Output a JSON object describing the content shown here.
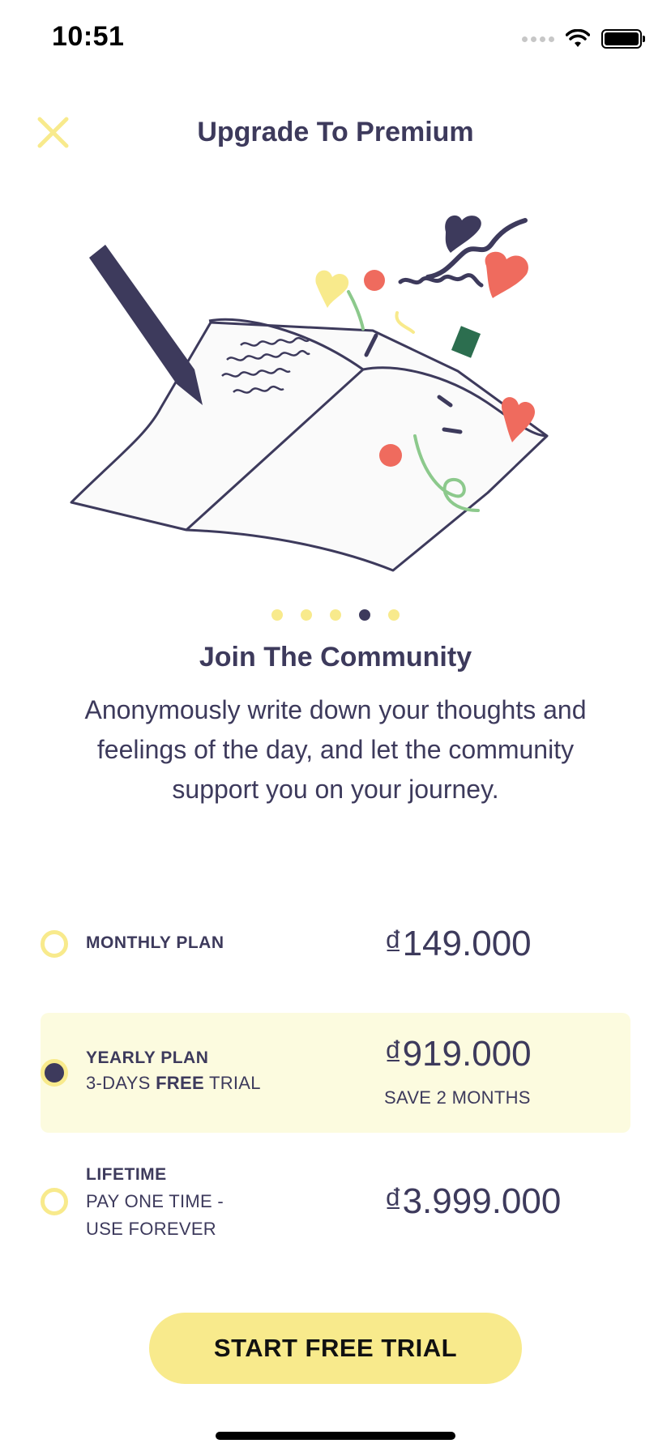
{
  "status_bar": {
    "time": "10:51"
  },
  "header": {
    "title": "Upgrade To Premium"
  },
  "colors": {
    "accent_yellow": "#f8ea8c",
    "text_navy": "#3d3a5c",
    "selected_bg": "#fcfbdf"
  },
  "pager": {
    "count": 5,
    "active_index": 3
  },
  "feature": {
    "title": "Join The Community",
    "description": "Anonymously write down your thoughts and feelings of the day, and let the community support you on your journey."
  },
  "plans": {
    "monthly": {
      "name": "MONTHLY PLAN",
      "price": "₫149.000"
    },
    "yearly": {
      "name": "YEARLY PLAN",
      "sub_prefix": "3-DAYS ",
      "sub_bold": "FREE",
      "sub_suffix": " TRIAL",
      "price": "₫919.000",
      "save": "SAVE 2 MONTHS"
    },
    "lifetime": {
      "name": "LIFETIME",
      "sub_line1": "PAY ONE TIME -",
      "sub_line2": "USE FOREVER",
      "price": "₫3.999.000"
    },
    "selected": "yearly"
  },
  "cta": {
    "label": "START FREE TRIAL"
  }
}
